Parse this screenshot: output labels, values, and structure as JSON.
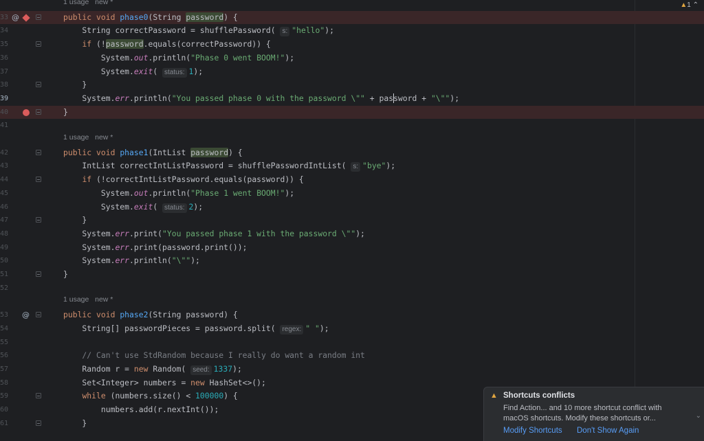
{
  "editor": {
    "warning_count": "1",
    "lines": [
      {
        "n": "",
        "kind": "meta",
        "text": "1 usage   new *"
      },
      {
        "n": "33",
        "bp": true,
        "gutter": "at-diamond",
        "fold": true,
        "tokens": [
          [
            "kw",
            "public "
          ],
          [
            "kw",
            "void "
          ],
          [
            "fn",
            "phase0"
          ],
          [
            "",
            "(String "
          ],
          [
            "hl",
            "password"
          ],
          [
            "",
            ") {"
          ]
        ]
      },
      {
        "n": "34",
        "tokens": [
          [
            "",
            "    String correctPassword = shufflePassword( "
          ],
          [
            "hint",
            "s:"
          ],
          [
            "str",
            "\"hello\""
          ],
          [
            "",
            ");"
          ]
        ]
      },
      {
        "n": "35",
        "fold": true,
        "tokens": [
          [
            "",
            "    "
          ],
          [
            "kw",
            "if "
          ],
          [
            "",
            "(!"
          ],
          [
            "hl",
            "password"
          ],
          [
            "",
            ".equals(correctPassword)) {"
          ]
        ]
      },
      {
        "n": "36",
        "tokens": [
          [
            "",
            "        System."
          ],
          [
            "st",
            "out"
          ],
          [
            "",
            ".println("
          ],
          [
            "str",
            "\"Phase 0 went BOOM!\""
          ],
          [
            "",
            ");"
          ]
        ]
      },
      {
        "n": "37",
        "tokens": [
          [
            "",
            "        System."
          ],
          [
            "st",
            "exit"
          ],
          [
            "",
            "( "
          ],
          [
            "hint",
            "status:"
          ],
          [
            "num",
            "1"
          ],
          [
            "",
            ");"
          ]
        ]
      },
      {
        "n": "38",
        "fold": true,
        "tokens": [
          [
            "",
            "    }"
          ]
        ]
      },
      {
        "n": "39",
        "cur": true,
        "tokens": [
          [
            "",
            "    System."
          ],
          [
            "st",
            "err"
          ],
          [
            "",
            ".println("
          ],
          [
            "str",
            "\"You passed phase 0 with the password \\\"\""
          ],
          [
            "",
            " + pas"
          ],
          [
            "caret",
            ""
          ],
          [
            "",
            "sword + "
          ],
          [
            "str",
            "\"\\\"\""
          ],
          [
            "",
            ");"
          ]
        ]
      },
      {
        "n": "40",
        "bp": true,
        "gutter": "dot",
        "fold": true,
        "tokens": [
          [
            "",
            "}"
          ]
        ]
      },
      {
        "n": "41",
        "tokens": []
      },
      {
        "n": "",
        "kind": "meta",
        "text": "1 usage   new *"
      },
      {
        "n": "42",
        "fold": true,
        "tokens": [
          [
            "kw",
            "public "
          ],
          [
            "kw",
            "void "
          ],
          [
            "fn",
            "phase1"
          ],
          [
            "",
            "(IntList "
          ],
          [
            "hl",
            "password"
          ],
          [
            "",
            ") {"
          ]
        ]
      },
      {
        "n": "43",
        "tokens": [
          [
            "",
            "    IntList correctIntListPassword = shufflePasswordIntList( "
          ],
          [
            "hint",
            "s:"
          ],
          [
            "str",
            "\"bye\""
          ],
          [
            "",
            ");"
          ]
        ]
      },
      {
        "n": "44",
        "fold": true,
        "tokens": [
          [
            "",
            "    "
          ],
          [
            "kw",
            "if "
          ],
          [
            "",
            "(!correctIntListPassword.equals(password)) {"
          ]
        ]
      },
      {
        "n": "45",
        "tokens": [
          [
            "",
            "        System."
          ],
          [
            "st",
            "out"
          ],
          [
            "",
            ".println("
          ],
          [
            "str",
            "\"Phase 1 went BOOM!\""
          ],
          [
            "",
            ");"
          ]
        ]
      },
      {
        "n": "46",
        "tokens": [
          [
            "",
            "        System."
          ],
          [
            "st",
            "exit"
          ],
          [
            "",
            "( "
          ],
          [
            "hint",
            "status:"
          ],
          [
            "num",
            "2"
          ],
          [
            "",
            ");"
          ]
        ]
      },
      {
        "n": "47",
        "fold": true,
        "tokens": [
          [
            "",
            "    }"
          ]
        ]
      },
      {
        "n": "48",
        "tokens": [
          [
            "",
            "    System."
          ],
          [
            "st",
            "err"
          ],
          [
            "",
            ".print("
          ],
          [
            "str",
            "\"You passed phase 1 with the password \\\"\""
          ],
          [
            "",
            ");"
          ]
        ]
      },
      {
        "n": "49",
        "tokens": [
          [
            "",
            "    System."
          ],
          [
            "st",
            "err"
          ],
          [
            "",
            ".print(password.print());"
          ]
        ]
      },
      {
        "n": "50",
        "tokens": [
          [
            "",
            "    System."
          ],
          [
            "st",
            "err"
          ],
          [
            "",
            ".println("
          ],
          [
            "str",
            "\"\\\"\""
          ],
          [
            "",
            ");"
          ]
        ]
      },
      {
        "n": "51",
        "fold": true,
        "tokens": [
          [
            "",
            "}"
          ]
        ]
      },
      {
        "n": "52",
        "tokens": []
      },
      {
        "n": "",
        "kind": "meta",
        "text": "1 usage   new *"
      },
      {
        "n": "53",
        "gutter": "at",
        "fold": true,
        "tokens": [
          [
            "kw",
            "public "
          ],
          [
            "kw",
            "void "
          ],
          [
            "fn",
            "phase2"
          ],
          [
            "",
            "(String password) {"
          ]
        ]
      },
      {
        "n": "54",
        "tokens": [
          [
            "",
            "    String[] passwordPieces = password.split( "
          ],
          [
            "hint",
            "regex:"
          ],
          [
            "str",
            "\" \""
          ],
          [
            "",
            ");"
          ]
        ]
      },
      {
        "n": "55",
        "tokens": []
      },
      {
        "n": "56",
        "tokens": [
          [
            "cmt",
            "    // Can't use StdRandom because I really do want a random int"
          ]
        ]
      },
      {
        "n": "57",
        "tokens": [
          [
            "",
            "    Random r = "
          ],
          [
            "kw",
            "new "
          ],
          [
            "",
            "Random( "
          ],
          [
            "hint",
            "seed:"
          ],
          [
            "num",
            "1337"
          ],
          [
            "",
            ");"
          ]
        ]
      },
      {
        "n": "58",
        "tokens": [
          [
            "",
            "    Set<Integer> numbers = "
          ],
          [
            "kw",
            "new "
          ],
          [
            "",
            "HashSet<>();"
          ]
        ]
      },
      {
        "n": "59",
        "fold": true,
        "tokens": [
          [
            "",
            "    "
          ],
          [
            "kw",
            "while "
          ],
          [
            "",
            "(numbers.size() < "
          ],
          [
            "num",
            "100000"
          ],
          [
            "",
            ") {"
          ]
        ]
      },
      {
        "n": "60",
        "tokens": [
          [
            "",
            "        numbers.add(r.nextInt());"
          ]
        ]
      },
      {
        "n": "61",
        "fold": true,
        "tokens": [
          [
            "",
            "    }"
          ]
        ]
      }
    ]
  },
  "notification": {
    "title": "Shortcuts conflicts",
    "body": "Find Action... and 10 more shortcut conflict with macOS shortcuts. Modify these shortcuts or...",
    "modify_label": "Modify Shortcuts",
    "dismiss_label": "Don't Show Again"
  }
}
